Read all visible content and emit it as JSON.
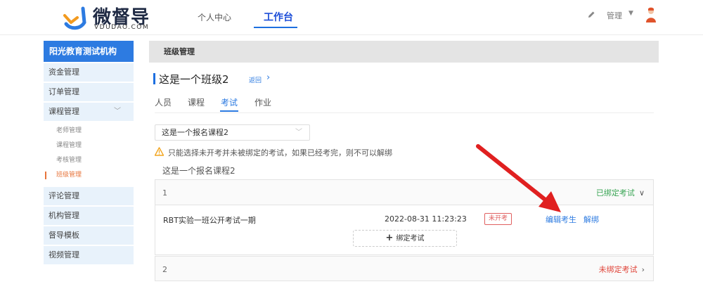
{
  "header": {
    "logo_title": "微督导",
    "logo_sub": "VDUDAO.COM",
    "nav": {
      "personal": "个人中心",
      "workbench": "工作台"
    },
    "admin_label": "管理",
    "icons": {
      "edit": "pencil-icon",
      "dropdown": "caret-down-icon",
      "avatar": "user-avatar-icon"
    }
  },
  "sidebar": {
    "org_title": "阳光教育测试机构",
    "items": [
      {
        "label": "资金管理"
      },
      {
        "label": "订单管理"
      },
      {
        "label": "课程管理",
        "expanded": true
      }
    ],
    "submenu": [
      {
        "label": "老师管理",
        "active": false
      },
      {
        "label": "课程管理",
        "active": false
      },
      {
        "label": "考核管理",
        "active": false
      },
      {
        "label": "班级管理",
        "active": true
      }
    ],
    "items_after": [
      {
        "label": "评论管理"
      },
      {
        "label": "机构管理"
      },
      {
        "label": "督导模板"
      },
      {
        "label": "视频管理"
      }
    ]
  },
  "main": {
    "crumb": "班级管理",
    "class_title": "这是一个班级2",
    "back_label": "返回",
    "tabs": [
      {
        "label": "人员",
        "active": false
      },
      {
        "label": "课程",
        "active": false
      },
      {
        "label": "考试",
        "active": true
      },
      {
        "label": "作业",
        "active": false
      }
    ],
    "course_select": {
      "value": "这是一个报名课程2"
    },
    "warning": "只能选择未开考并未被绑定的考试，如果已经考完，则不可以解绑",
    "course_name": "这是一个报名课程2",
    "groups": [
      {
        "index": "1",
        "status": "已绑定考试",
        "status_type": "bound",
        "expanded": true,
        "exams": [
          {
            "name": "RBT实验一班公开考试一期",
            "time": "2022-08-31 11:23:23",
            "badge": "未开考",
            "edit": "编辑考生",
            "unbind": "解绑"
          }
        ],
        "bind_button": "绑定考试"
      },
      {
        "index": "2",
        "status": "未绑定考试",
        "status_type": "unbound",
        "expanded": false
      }
    ]
  },
  "colors": {
    "accent": "#2d7be1",
    "bound": "#3aa555",
    "unbound": "#e0453a",
    "active_sub": "#e7743b",
    "annotation_arrow": "#e02020"
  }
}
